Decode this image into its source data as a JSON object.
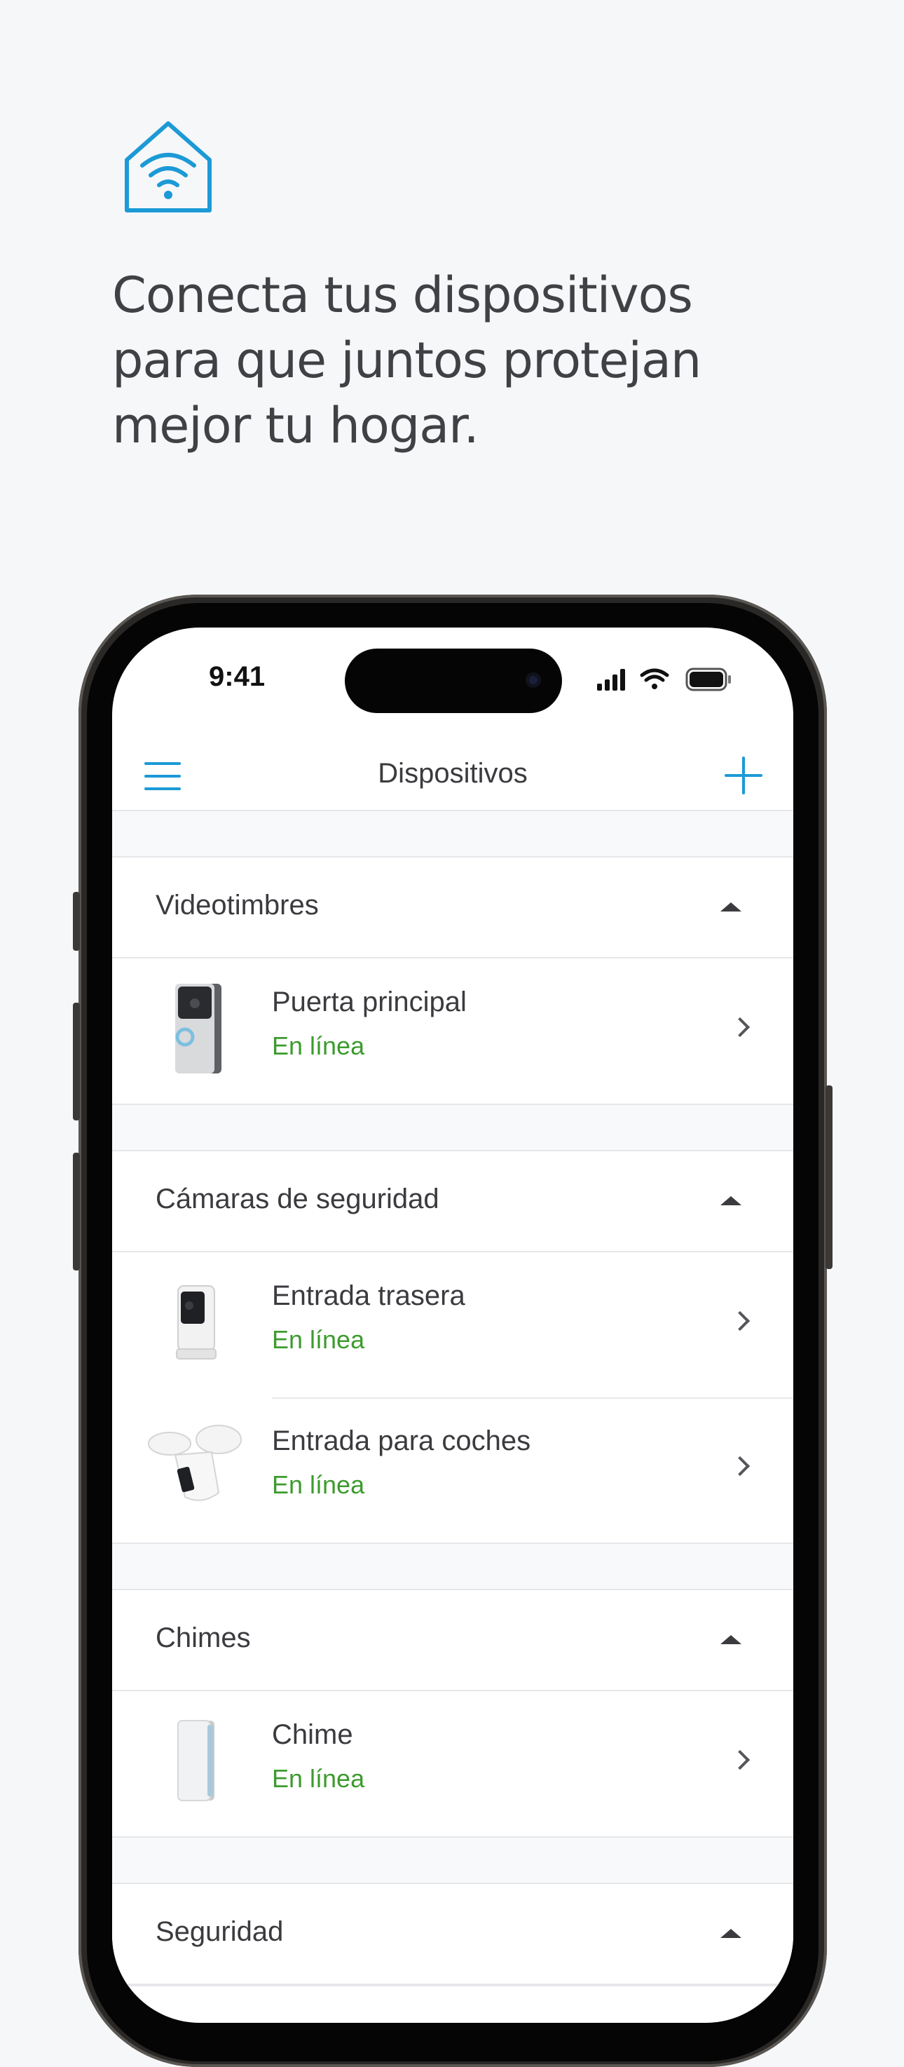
{
  "headline": {
    "lines": [
      "Conecta tus dispositivos",
      "para que juntos protejan",
      "mejor tu hogar."
    ]
  },
  "icons": {
    "hero": "house-wifi-icon",
    "menu": "hamburger-menu-icon",
    "add": "plus-icon",
    "signal": "cellular-signal-icon",
    "wifi": "wifi-icon",
    "battery": "battery-icon"
  },
  "colors": {
    "accent": "#1c9ad6",
    "online": "#3d9b2e",
    "background": "#f6f7f9"
  },
  "status_bar": {
    "time": "9:41"
  },
  "nav": {
    "title": "Dispositivos"
  },
  "sections": [
    {
      "title": "Videotimbres",
      "devices": [
        {
          "name": "Puerta principal",
          "status": "En línea",
          "thumb": "video-doorbell"
        }
      ]
    },
    {
      "title": "Cámaras de seguridad",
      "devices": [
        {
          "name": "Entrada trasera",
          "status": "En línea",
          "thumb": "stick-up-cam"
        },
        {
          "name": "Entrada para coches",
          "status": "En línea",
          "thumb": "floodlight-cam"
        }
      ]
    },
    {
      "title": "Chimes",
      "devices": [
        {
          "name": "Chime",
          "status": "En línea",
          "thumb": "chime"
        }
      ]
    },
    {
      "title": "Seguridad",
      "devices": []
    }
  ]
}
